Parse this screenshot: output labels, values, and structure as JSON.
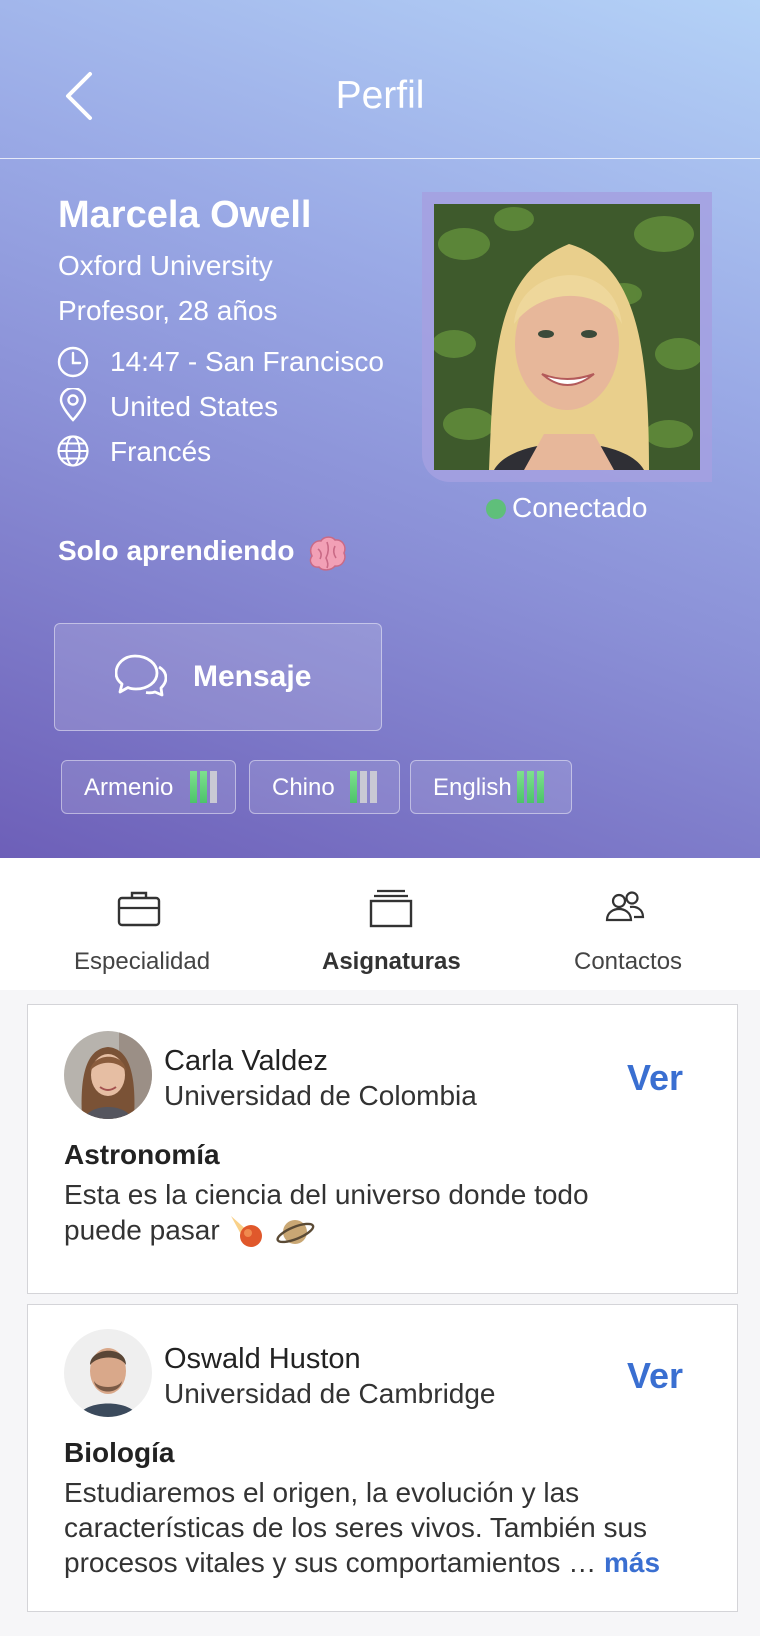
{
  "header": {
    "title": "Perfil"
  },
  "profile": {
    "name": "Marcela Owell",
    "university": "Oxford University",
    "role_age": "Profesor, 28 años",
    "local_time": "14:47 - San Francisco",
    "country": "United States",
    "language": "Francés",
    "status": "Conectado",
    "tagline": "Solo aprendiendo",
    "message_button": "Mensaje"
  },
  "languages": [
    {
      "label": "Armenio",
      "level": 2,
      "max": 3
    },
    {
      "label": "Chino",
      "level": 1,
      "max": 3
    },
    {
      "label": "English",
      "level": 3,
      "max": 3
    }
  ],
  "tabs": [
    {
      "label": "Especialidad",
      "active": false
    },
    {
      "label": "Asignaturas",
      "active": true
    },
    {
      "label": "Contactos",
      "active": false
    }
  ],
  "subjects": [
    {
      "teacher": "Carla Valdez",
      "university": "Universidad de Colombia",
      "action": "Ver",
      "subject": "Astronomía",
      "description_line1": "Esta es la ciencia del universo donde todo",
      "description_line2": "puede pasar"
    },
    {
      "teacher": "Oswald Huston",
      "university": "Universidad de Cambridge",
      "action": "Ver",
      "subject": "Biología",
      "description_line1": "Estudiaremos el origen, la evolución y las",
      "description_line2": "características de los seres vivos. También sus",
      "description_line3": "procesos vitales y sus comportamientos …",
      "more": "más"
    }
  ],
  "colors": {
    "accent": "#3a6fd1",
    "online": "#5fbf7a",
    "level_on": "#4cc46a",
    "level_off": "#c9c9d4"
  }
}
